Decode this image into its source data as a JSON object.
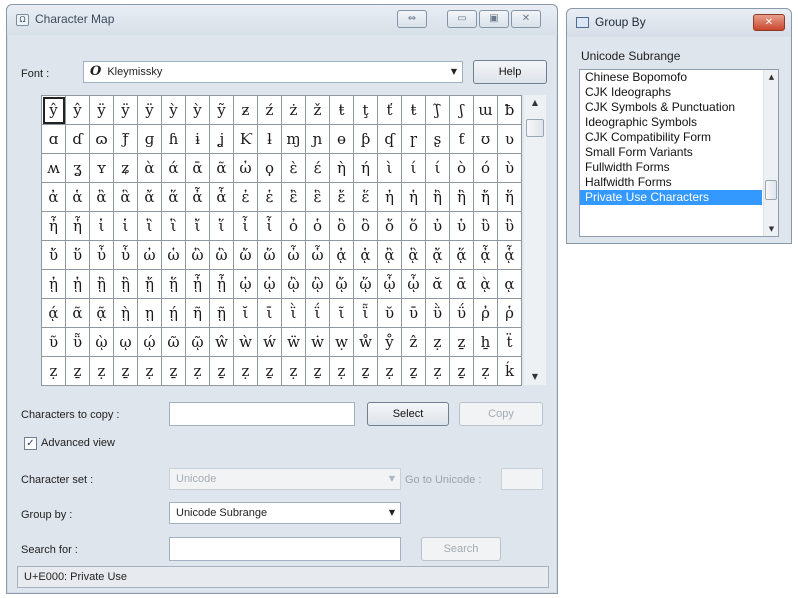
{
  "char_map": {
    "title": "Character Map",
    "font_label": "Font :",
    "font_icon": "O",
    "font_value": "Kleymissky",
    "help_label": "Help",
    "grid": [
      [
        "ŷ",
        "ŷ",
        "ÿ",
        "ÿ",
        "ÿ",
        "ỳ",
        "ỳ",
        "ỹ",
        "ƶ",
        "ź",
        "ż",
        "ž",
        "ŧ",
        "ţ",
        "ť",
        "ŧ",
        "ʃ̃",
        "ʃ",
        "ɯ",
        "ƀ"
      ],
      [
        "ɑ",
        "ɗ",
        "ɷ",
        "ƒ̃",
        "ɡ",
        "ɦ",
        "ɨ",
        "ʝ",
        "Ƙ",
        "ƚ",
        "ɱ",
        "ɲ",
        "ɵ",
        "ƥ",
        "ʠ",
        "ɼ",
        "ʂ",
        "ƭ",
        "ʊ",
        "ʋ"
      ],
      [
        "ʍ",
        "ʓ",
        "ʏ",
        "ʑ",
        "ὰ",
        "ά",
        "ᾱ",
        "ᾶ",
        "ὠ",
        "ϙ",
        "ὲ",
        "έ",
        "ὴ",
        "ή",
        "ὶ",
        "ί",
        "ί",
        "ὸ",
        "ό",
        "ὺ"
      ],
      [
        "ἀ",
        "ἁ",
        "ἂ",
        "ἃ",
        "ἄ",
        "ἅ",
        "ἆ",
        "ἇ",
        "ἐ",
        "ἑ",
        "ἒ",
        "ἓ",
        "ἔ",
        "ἕ",
        "ἠ",
        "ἡ",
        "ἢ",
        "ἣ",
        "ἤ",
        "ἥ"
      ],
      [
        "ἦ",
        "ἧ",
        "ἰ",
        "ἱ",
        "ἲ",
        "ἳ",
        "ἴ",
        "ἵ",
        "ἶ",
        "ἷ",
        "ὀ",
        "ὁ",
        "ὂ",
        "ὃ",
        "ὄ",
        "ὅ",
        "ὐ",
        "ὑ",
        "ὒ",
        "ὓ"
      ],
      [
        "ὔ",
        "ὕ",
        "ὖ",
        "ὗ",
        "ὠ",
        "ὡ",
        "ὢ",
        "ὣ",
        "ὤ",
        "ὥ",
        "ὦ",
        "ὧ",
        "ᾀ",
        "ᾁ",
        "ᾂ",
        "ᾃ",
        "ᾄ",
        "ᾅ",
        "ᾆ",
        "ᾇ"
      ],
      [
        "ᾐ",
        "ᾑ",
        "ᾒ",
        "ᾓ",
        "ᾔ",
        "ᾕ",
        "ᾖ",
        "ᾗ",
        "ᾠ",
        "ᾡ",
        "ᾢ",
        "ᾣ",
        "ᾤ",
        "ᾥ",
        "ᾦ",
        "ᾧ",
        "ᾰ",
        "ᾱ",
        "ᾲ",
        "ᾳ"
      ],
      [
        "ᾴ",
        "ᾶ",
        "ᾷ",
        "ῂ",
        "ῃ",
        "ῄ",
        "ῆ",
        "ῇ",
        "ῐ",
        "ῑ",
        "ῒ",
        "ΐ",
        "ῖ",
        "ῗ",
        "ῠ",
        "ῡ",
        "ῢ",
        "ΰ",
        "ῤ",
        "ῥ"
      ],
      [
        "ῦ",
        "ῧ",
        "ῲ",
        "ῳ",
        "ῴ",
        "ῶ",
        "ῷ",
        "ŵ",
        "ẁ",
        "ẃ",
        "ẅ",
        "ẇ",
        "ẉ",
        "ẘ",
        "ẙ",
        "ẑ",
        "ẓ",
        "ẕ",
        "ẖ",
        "ẗ"
      ],
      [
        "ẓ",
        "ẕ",
        "ẓ",
        "ẕ",
        "ẓ",
        "ẕ",
        "ẓ",
        "ẕ",
        "ẓ",
        "ẕ",
        "ẓ",
        "ẕ",
        "ẓ",
        "ẕ",
        "ẓ",
        "ẕ",
        "ẓ",
        "ẕ",
        "ẓ",
        "ḱ"
      ]
    ],
    "chars_to_copy_label": "Characters to copy :",
    "chars_to_copy_value": "",
    "select_label": "Select",
    "copy_label": "Copy",
    "advanced_view_label": "Advanced view",
    "advanced_view_checked": true,
    "charset_label": "Character set :",
    "charset_value": "Unicode",
    "goto_unicode_label": "Go to Unicode :",
    "group_by_label": "Group by :",
    "group_by_value": "Unicode Subrange",
    "search_label": "Search for :",
    "search_value": "",
    "search_button": "Search",
    "status": "U+E000: Private Use"
  },
  "group_by": {
    "title": "Group By",
    "subtitle": "Unicode Subrange",
    "items": [
      "Chinese Bopomofo",
      "CJK Ideographs",
      "CJK Symbols & Punctuation",
      "Ideographic Symbols",
      "CJK Compatibility Form",
      "Small Form Variants",
      "Fullwidth Forms",
      "Halfwidth Forms",
      "Private Use Characters"
    ],
    "selected_index": 8
  },
  "icons": {
    "restore": "restore-icon",
    "minimize": "minimize-icon",
    "maximize": "maximize-icon",
    "close": "close-icon"
  },
  "colors": {
    "selection": "#3399ff",
    "close_button": "#c9462c",
    "window_bg": "#dfe5ec"
  }
}
